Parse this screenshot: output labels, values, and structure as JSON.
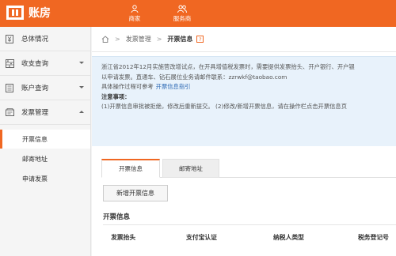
{
  "header": {
    "app_title": "账房",
    "nav": [
      {
        "label": "商家",
        "icon": "user-icon"
      },
      {
        "label": "服务商",
        "icon": "people-icon"
      }
    ]
  },
  "sidebar": {
    "items": [
      {
        "label": "总体情况",
        "icon": "yen-icon"
      },
      {
        "label": "收支查询",
        "icon": "abacus-icon"
      },
      {
        "label": "账户查询",
        "icon": "ledger-icon"
      },
      {
        "label": "发票管理",
        "icon": "invoice-icon"
      }
    ],
    "subitems": [
      {
        "label": "开票信息"
      },
      {
        "label": "邮寄地址"
      },
      {
        "label": "申请发票"
      }
    ]
  },
  "breadcrumb": {
    "section": "发票管理",
    "current": "开票信息",
    "help": "?"
  },
  "notice": {
    "line1": "浙江省2012年12月实施营改增试点，在开具增值税发票时，需要提供发票抬头、开户银行、开户银",
    "line2": "以申请发票。直通车、钻石展位业务请邮件联系：zzrwkf@taobao.com",
    "line3_prefix": "具体操作过程可参考",
    "line3_link": "开票信息指引",
    "heading": "注意事项：",
    "line4": "(1)开票信息审批被拒绝，修改后重新提交。 (2)修改/新增开票信息，请在操作栏点击开票信息页"
  },
  "tabs": [
    {
      "label": "开票信息"
    },
    {
      "label": "邮寄地址"
    }
  ],
  "add_button": "新增开票信息",
  "section_title": "开票信息",
  "table": {
    "columns": [
      "发票抬头",
      "支付宝认证",
      "纳税人类型",
      "税务登记号"
    ]
  }
}
